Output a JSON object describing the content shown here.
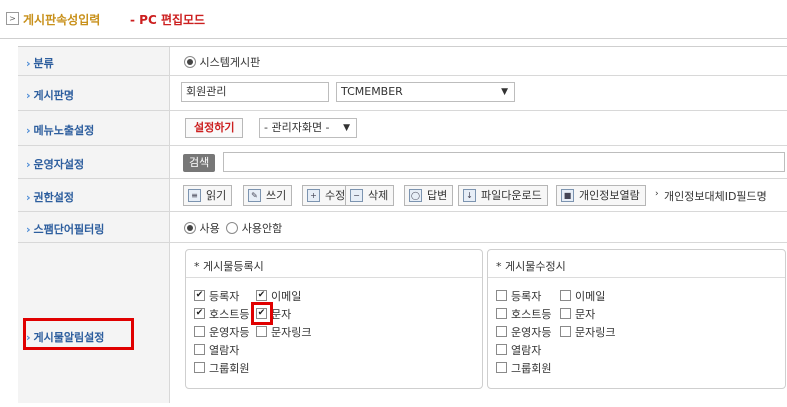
{
  "header": {
    "section": "게시판속성입력",
    "mode": "- PC 편집모드"
  },
  "rows": {
    "category": {
      "label": "분류",
      "option": "시스템게시판"
    },
    "board_name": {
      "label": "게시판명",
      "value": "회원관리",
      "select_value": "TCMEMBER"
    },
    "menu_display": {
      "label": "메뉴노출설정",
      "button": "설정하기",
      "select_value": "- 관리자화면 -"
    },
    "operator": {
      "label": "운영자설정",
      "search_button": "검색",
      "search_value": ""
    },
    "permissions": {
      "label": "권한설정",
      "buttons": [
        "읽기",
        "쓰기",
        "수정",
        "삭제",
        "답변",
        "파일다운로드",
        "개인정보열람"
      ],
      "trailing_text": "개인정보대체ID필드명"
    },
    "spam_filter": {
      "label": "스팸단어필터링",
      "options": [
        "사용",
        "사용안함"
      ],
      "selected": "사용"
    },
    "alarm": {
      "label": "게시물알림설정",
      "register_panel": {
        "title": "* 게시물등록시",
        "items": [
          {
            "label": "등록자",
            "checked": true
          },
          {
            "label": "이메일",
            "checked": true
          },
          {
            "label": "호스트등",
            "checked": true
          },
          {
            "label": "문자",
            "checked": true
          },
          {
            "label": "운영자등",
            "checked": false
          },
          {
            "label": "문자링크",
            "checked": false
          },
          {
            "label": "열람자",
            "checked": false
          },
          {
            "label": "그룹회원",
            "checked": false
          }
        ]
      },
      "modify_panel": {
        "title": "* 게시물수정시",
        "items": [
          {
            "label": "등록자",
            "checked": false
          },
          {
            "label": "이메일",
            "checked": false
          },
          {
            "label": "호스트등",
            "checked": false
          },
          {
            "label": "문자",
            "checked": false
          },
          {
            "label": "운영자등",
            "checked": false
          },
          {
            "label": "문자링크",
            "checked": false
          },
          {
            "label": "열람자",
            "checked": false
          },
          {
            "label": "그룹회원",
            "checked": false
          }
        ]
      }
    }
  },
  "colors": {
    "label_text": "#2d5e9e",
    "accent_red": "#cc1f1f",
    "title_gold": "#c8901a",
    "highlight": "#e00000"
  }
}
